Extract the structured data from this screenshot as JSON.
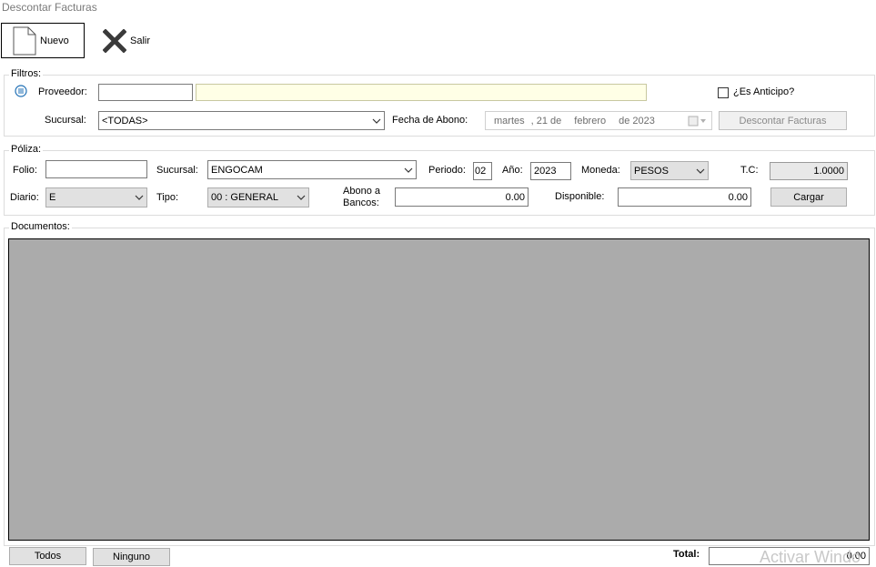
{
  "window": {
    "title": "Descontar Facturas"
  },
  "toolbar": {
    "nuevo_label": "Nuevo",
    "salir_label": "Salir"
  },
  "filtros": {
    "title": "Filtros:",
    "proveedor_label": "Proveedor:",
    "proveedor_code": "",
    "proveedor_name": "",
    "anticipo_label": "¿Es Anticipo?",
    "anticipo_checked": false,
    "sucursal_label": "Sucursal:",
    "sucursal_value": "<TODAS>",
    "fecha_label": "Fecha de Abono:",
    "fecha_weekday": "martes",
    "fecha_day": ", 21 de",
    "fecha_month": "febrero",
    "fecha_year": "de 2023",
    "descontar_label": "Descontar Facturas"
  },
  "poliza": {
    "title": "Póliza:",
    "folio_label": "Folio:",
    "folio_value": "",
    "sucursal_label": "Sucursal:",
    "sucursal_value": "ENGOCAM",
    "periodo_label": "Periodo:",
    "periodo_value": "02",
    "anio_label": "Año:",
    "anio_value": "2023",
    "moneda_label": "Moneda:",
    "moneda_value": "PESOS",
    "tc_label": "T.C:",
    "tc_value": "1.0000",
    "diario_label": "Diario:",
    "diario_value": "E",
    "tipo_label": "Tipo:",
    "tipo_value": "00 : GENERAL",
    "abono_label_1": "Abono a",
    "abono_label_2": "Bancos:",
    "abono_value": "0.00",
    "disponible_label": "Disponible:",
    "disponible_value": "0.00",
    "cargar_label": "Cargar"
  },
  "documentos": {
    "title": "Documentos:"
  },
  "footer": {
    "todos_label": "Todos",
    "ninguno_label": "Ninguno",
    "total_label": "Total:",
    "total_value": "0.00",
    "watermark": "Activar Windo"
  }
}
